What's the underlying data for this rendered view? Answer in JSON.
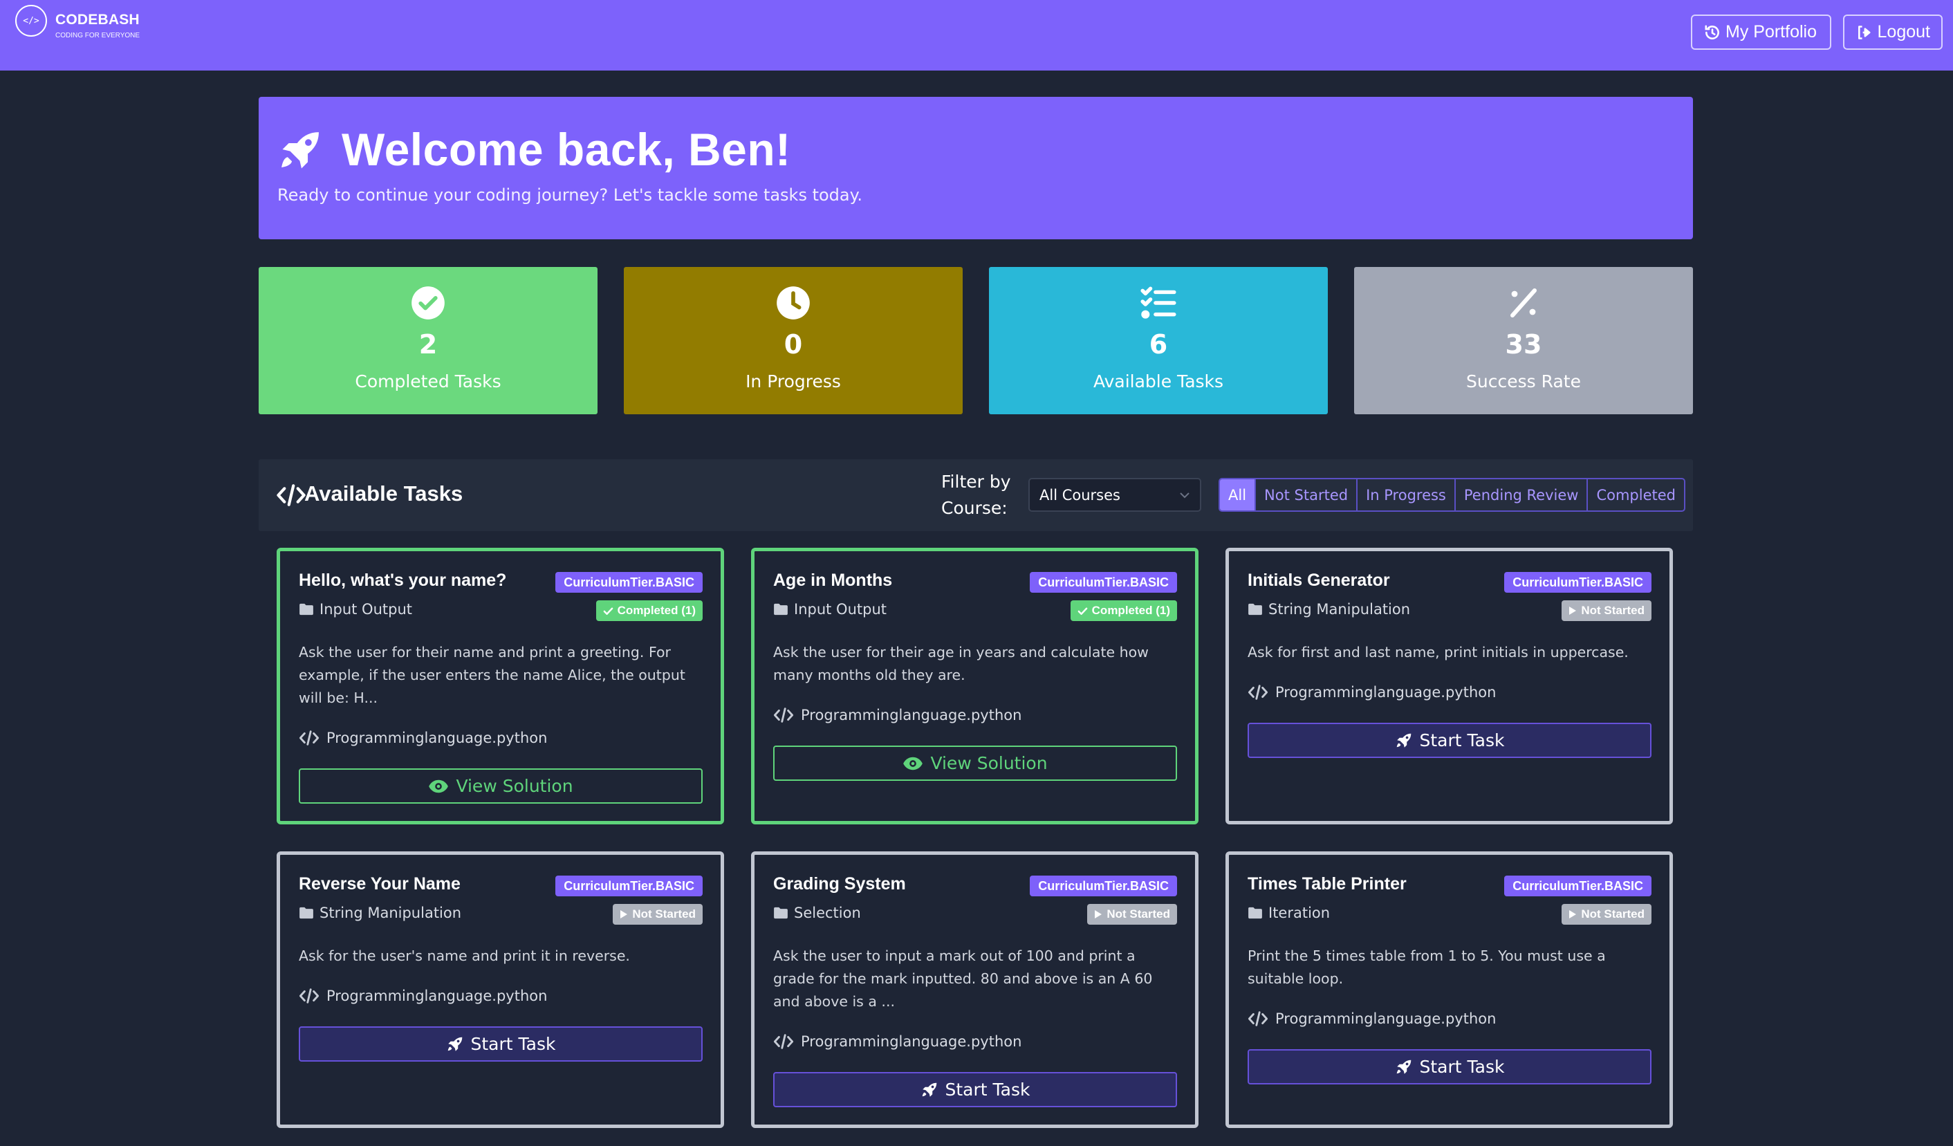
{
  "brand": {
    "logo_text": "</>",
    "name": "CODEBASH",
    "tagline": "CODING FOR EVERYONE"
  },
  "nav": {
    "portfolio_label": "My Portfolio",
    "logout_label": "Logout"
  },
  "welcome": {
    "title": "Welcome back, Ben!",
    "subtitle": "Ready to continue your coding journey? Let's tackle some tasks today."
  },
  "stats": [
    {
      "value": "2",
      "label": "Completed Tasks",
      "icon": "check-circle-icon",
      "color": "#6bd97e"
    },
    {
      "value": "0",
      "label": "In Progress",
      "icon": "clock-icon",
      "color": "#927c00"
    },
    {
      "value": "6",
      "label": "Available Tasks",
      "icon": "list-check-icon",
      "color": "#29b8d8"
    },
    {
      "value": "33",
      "label": "Success Rate",
      "icon": "percent-icon",
      "color": "#a1a7b5"
    }
  ],
  "tasks_panel": {
    "title": "Available Tasks",
    "filter_label": "Filter by Course:",
    "course_select": "All Courses",
    "status_filters": [
      "All",
      "Not Started",
      "In Progress",
      "Pending Review",
      "Completed"
    ],
    "active_filter": "All"
  },
  "tasks": [
    {
      "title": "Hello, what's your name?",
      "tier": "CurriculumTier.BASIC",
      "status": "Completed (1)",
      "category": "Input Output",
      "description": "Ask the user for their name and print a greeting. For example, if the user enters the name Alice, the output will be: H...",
      "language": "Programminglanguage.python",
      "action": "View Solution"
    },
    {
      "title": "Age in Months",
      "tier": "CurriculumTier.BASIC",
      "status": "Completed (1)",
      "category": "Input Output",
      "description": "Ask the user for their age in years and calculate how many months old they are.",
      "language": "Programminglanguage.python",
      "action": "View Solution"
    },
    {
      "title": "Initials Generator",
      "tier": "CurriculumTier.BASIC",
      "status": "Not Started",
      "category": "String Manipulation",
      "description": "Ask for first and last name, print initials in uppercase.",
      "language": "Programminglanguage.python",
      "action": "Start Task"
    },
    {
      "title": "Reverse Your Name",
      "tier": "CurriculumTier.BASIC",
      "status": "Not Started",
      "category": "String Manipulation",
      "description": "Ask for the user's name and print it in reverse.",
      "language": "Programminglanguage.python",
      "action": "Start Task"
    },
    {
      "title": "Grading System",
      "tier": "CurriculumTier.BASIC",
      "status": "Not Started",
      "category": "Selection",
      "description": "Ask the user to input a mark out of 100 and print a grade for the mark inputted. 80 and above is an A 60 and above is a ...",
      "language": "Programminglanguage.python",
      "action": "Start Task"
    },
    {
      "title": "Times Table Printer",
      "tier": "CurriculumTier.BASIC",
      "status": "Not Started",
      "category": "Iteration",
      "description": "Print the 5 times table from 1 to 5. You must use a suitable loop.",
      "language": "Programminglanguage.python",
      "action": "Start Task"
    }
  ]
}
